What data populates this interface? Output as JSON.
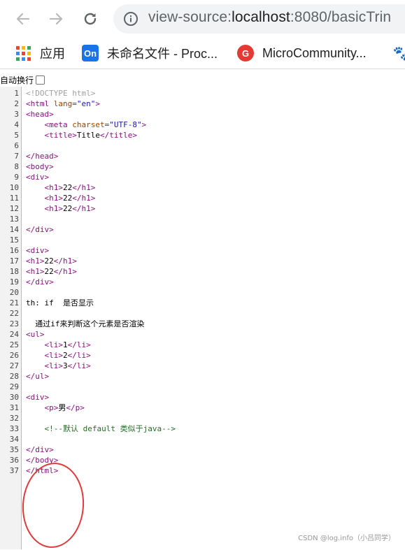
{
  "toolbar": {
    "url_scheme": "view-source:",
    "url_host": "localhost",
    "url_rest": ":8080/basicTrin"
  },
  "bookmarks": [
    {
      "icon": "apps-grid-icon",
      "label": "应用"
    },
    {
      "icon": "on-icon",
      "icon_text": "On",
      "label": "未命名文件 - Proc..."
    },
    {
      "icon": "microcommunity-icon",
      "icon_text": "G",
      "label": "MicroCommunity..."
    },
    {
      "icon": "baidu-paw-icon",
      "label": ""
    }
  ],
  "wrap": {
    "label": "自动换行",
    "checked": false
  },
  "code_lines": [
    {
      "n": "1",
      "tokens": [
        {
          "t": "doct",
          "v": "<!DOCTYPE html>"
        }
      ]
    },
    {
      "n": "2",
      "tokens": [
        {
          "t": "tag",
          "v": "<html "
        },
        {
          "t": "attr",
          "v": "lang"
        },
        {
          "t": "tag",
          "v": "="
        },
        {
          "t": "val",
          "v": "\"en\""
        },
        {
          "t": "tag",
          "v": ">"
        }
      ]
    },
    {
      "n": "3",
      "tokens": [
        {
          "t": "tag",
          "v": "<head>"
        }
      ]
    },
    {
      "n": "4",
      "tokens": [
        {
          "t": "txt",
          "v": "    "
        },
        {
          "t": "tag",
          "v": "<meta "
        },
        {
          "t": "attr",
          "v": "charset"
        },
        {
          "t": "tag",
          "v": "="
        },
        {
          "t": "val",
          "v": "\"UTF-8\""
        },
        {
          "t": "tag",
          "v": ">"
        }
      ]
    },
    {
      "n": "5",
      "tokens": [
        {
          "t": "txt",
          "v": "    "
        },
        {
          "t": "tag",
          "v": "<title>"
        },
        {
          "t": "txt",
          "v": "Title"
        },
        {
          "t": "tag",
          "v": "</title>"
        }
      ]
    },
    {
      "n": "6",
      "tokens": []
    },
    {
      "n": "7",
      "tokens": [
        {
          "t": "tag",
          "v": "</head>"
        }
      ]
    },
    {
      "n": "8",
      "tokens": [
        {
          "t": "tag",
          "v": "<body>"
        }
      ]
    },
    {
      "n": "9",
      "tokens": [
        {
          "t": "tag",
          "v": "<div>"
        }
      ]
    },
    {
      "n": "10",
      "tokens": [
        {
          "t": "txt",
          "v": "    "
        },
        {
          "t": "tag",
          "v": "<h1>"
        },
        {
          "t": "txt",
          "v": "22"
        },
        {
          "t": "tag",
          "v": "</h1>"
        }
      ]
    },
    {
      "n": "11",
      "tokens": [
        {
          "t": "txt",
          "v": "    "
        },
        {
          "t": "tag",
          "v": "<h1>"
        },
        {
          "t": "txt",
          "v": "22"
        },
        {
          "t": "tag",
          "v": "</h1>"
        }
      ]
    },
    {
      "n": "12",
      "tokens": [
        {
          "t": "txt",
          "v": "    "
        },
        {
          "t": "tag",
          "v": "<h1>"
        },
        {
          "t": "txt",
          "v": "22"
        },
        {
          "t": "tag",
          "v": "</h1>"
        }
      ]
    },
    {
      "n": "13",
      "tokens": []
    },
    {
      "n": "14",
      "tokens": [
        {
          "t": "tag",
          "v": "</div>"
        }
      ]
    },
    {
      "n": "15",
      "tokens": []
    },
    {
      "n": "16",
      "tokens": [
        {
          "t": "tag",
          "v": "<div>"
        }
      ]
    },
    {
      "n": "17",
      "tokens": [
        {
          "t": "tag",
          "v": "<h1>"
        },
        {
          "t": "txt",
          "v": "22"
        },
        {
          "t": "tag",
          "v": "</h1>"
        }
      ]
    },
    {
      "n": "18",
      "tokens": [
        {
          "t": "tag",
          "v": "<h1>"
        },
        {
          "t": "txt",
          "v": "22"
        },
        {
          "t": "tag",
          "v": "</h1>"
        }
      ]
    },
    {
      "n": "19",
      "tokens": [
        {
          "t": "tag",
          "v": "</div>"
        }
      ]
    },
    {
      "n": "20",
      "tokens": []
    },
    {
      "n": "21",
      "tokens": [
        {
          "t": "txt",
          "v": "th: if  是否显示"
        }
      ]
    },
    {
      "n": "22",
      "tokens": []
    },
    {
      "n": "23",
      "tokens": [
        {
          "t": "txt",
          "v": "  通过if来判断这个元素是否渲染"
        }
      ]
    },
    {
      "n": "24",
      "tokens": [
        {
          "t": "tag",
          "v": "<ul>"
        }
      ]
    },
    {
      "n": "25",
      "tokens": [
        {
          "t": "txt",
          "v": "    "
        },
        {
          "t": "tag",
          "v": "<li>"
        },
        {
          "t": "txt",
          "v": "1"
        },
        {
          "t": "tag",
          "v": "</li>"
        }
      ]
    },
    {
      "n": "26",
      "tokens": [
        {
          "t": "txt",
          "v": "    "
        },
        {
          "t": "tag",
          "v": "<li>"
        },
        {
          "t": "txt",
          "v": "2"
        },
        {
          "t": "tag",
          "v": "</li>"
        }
      ]
    },
    {
      "n": "27",
      "tokens": [
        {
          "t": "txt",
          "v": "    "
        },
        {
          "t": "tag",
          "v": "<li>"
        },
        {
          "t": "txt",
          "v": "3"
        },
        {
          "t": "tag",
          "v": "</li>"
        }
      ]
    },
    {
      "n": "28",
      "tokens": [
        {
          "t": "tag",
          "v": "</ul>"
        }
      ]
    },
    {
      "n": "29",
      "tokens": []
    },
    {
      "n": "30",
      "tokens": [
        {
          "t": "tag",
          "v": "<div>"
        }
      ]
    },
    {
      "n": "31",
      "tokens": [
        {
          "t": "txt",
          "v": "    "
        },
        {
          "t": "tag",
          "v": "<p>"
        },
        {
          "t": "txt",
          "v": "男"
        },
        {
          "t": "tag",
          "v": "</p>"
        }
      ]
    },
    {
      "n": "32",
      "tokens": []
    },
    {
      "n": "33",
      "tokens": [
        {
          "t": "txt",
          "v": "    "
        },
        {
          "t": "cmt",
          "v": "<!--默认 default 类似于java-->"
        }
      ]
    },
    {
      "n": "34",
      "tokens": []
    },
    {
      "n": "35",
      "tokens": [
        {
          "t": "tag",
          "v": "</div>"
        }
      ]
    },
    {
      "n": "36",
      "tokens": [
        {
          "t": "tag",
          "v": "</body>"
        }
      ]
    },
    {
      "n": "37",
      "tokens": [
        {
          "t": "tag",
          "v": "</html>"
        }
      ]
    }
  ],
  "watermark": "CSDN @log.info（小吕同学）",
  "colors": {
    "tag": "#881280",
    "attr": "#994500",
    "value": "#1a1aa6",
    "comment": "#236e25",
    "doctype": "#a0a0a0",
    "annotation": "#e23a3a"
  }
}
